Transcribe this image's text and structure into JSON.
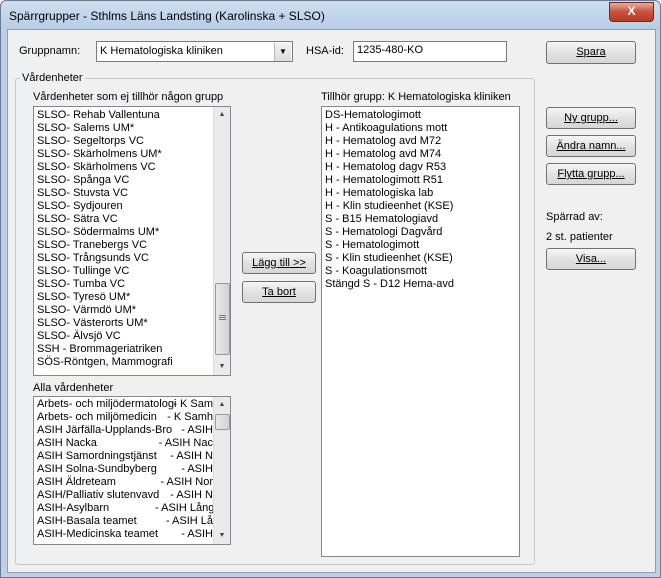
{
  "window": {
    "title": "Spärrgrupper - Sthlms Läns Landsting (Karolinska + SLSO)",
    "close_label": "X"
  },
  "form": {
    "gruppnamn_label": "Gruppnamn:",
    "gruppnamn_value": "K Hematologiska kliniken",
    "hsaid_label": "HSA-id:",
    "hsaid_value": "1235-480-KO",
    "spara_label": "Spara"
  },
  "vardenheter": {
    "group_label": "Vårdenheter",
    "left_label": "Vårdenheter som ej tillhör någon grupp",
    "left_items": [
      "SLSO- Rehab Vallentuna",
      "SLSO- Salems UM*",
      "SLSO- Segeltorps VC",
      "SLSO- Skärholmens UM*",
      "SLSO- Skärholmens VC",
      "SLSO- Spånga VC",
      "SLSO- Stuvsta VC",
      "SLSO- Sydjouren",
      "SLSO- Sätra VC",
      "SLSO- Södermalms UM*",
      "SLSO- Tranebergs VC",
      "SLSO- Trångsunds VC",
      "SLSO- Tullinge VC",
      "SLSO- Tumba VC",
      "SLSO- Tyresö UM*",
      "SLSO- Värmdö UM*",
      "SLSO- Västerorts UM*",
      "SLSO- Älvsjö VC",
      "SSH - Brommageriatriken",
      "SÖS-Röntgen, Mammografi"
    ],
    "lagg_till_label": "Lägg till >>",
    "ta_bort_label": "Ta bort",
    "right_label": "Tillhör grupp: K Hematologiska kliniken",
    "right_items": [
      "DS-Hematologimott",
      "H - Antikoagulations mott",
      "H - Hematolog avd M72",
      "H - Hematolog avd M74",
      "H - Hematolog dagv R53",
      "H - Hematologimott R51",
      "H - Hematologiska lab",
      "H - Klin studieenhet (KSE)",
      "S - B15 Hematologiavd",
      "S - Hematologi Dagvård",
      "S - Hematologimott",
      "S - Klin studieenhet (KSE)",
      "S - Koagulationsmott",
      "Stängd S - D12 Hema-avd"
    ],
    "all_label": "Alla vårdenheter",
    "all_items": [
      {
        "name": "Arbets- och miljödermatologi",
        "code": "- K Sam"
      },
      {
        "name": "Arbets- och miljömedicin",
        "code": "- K Samh"
      },
      {
        "name": "ASIH Järfälla-Upplands-Bro",
        "code": "- ASIH"
      },
      {
        "name": "ASIH Nacka",
        "code": "- ASIH Nac"
      },
      {
        "name": "ASIH Samordningstjänst",
        "code": "- ASIH N"
      },
      {
        "name": "ASIH Solna-Sundbyberg",
        "code": "- ASIH"
      },
      {
        "name": "ASIH Äldreteam",
        "code": "- ASIH Nor"
      },
      {
        "name": "ASIH/Palliativ slutenvavd",
        "code": "- ASIH N"
      },
      {
        "name": "ASIH-Asylbarn",
        "code": "- ASIH Lång"
      },
      {
        "name": "ASIH-Basala teamet",
        "code": "- ASIH Lå"
      },
      {
        "name": "ASIH-Medicinska teamet",
        "code": "- ASIH"
      }
    ]
  },
  "side": {
    "ny_grupp_label": "Ny grupp...",
    "andra_namn_label": "Ändra namn...",
    "flytta_grupp_label": "Flytta grupp...",
    "sparrad_av_label": "Spärrad av:",
    "sparrad_count": "2 st. patienter",
    "visa_label": "Visa..."
  }
}
